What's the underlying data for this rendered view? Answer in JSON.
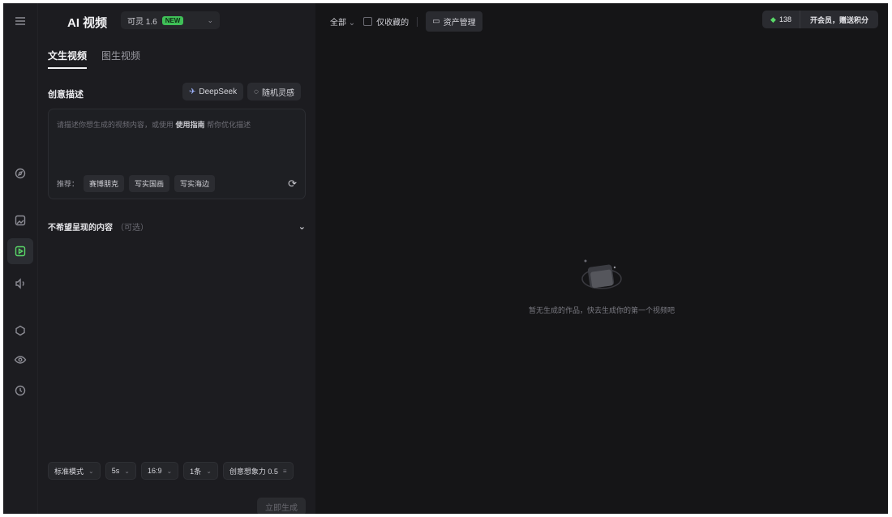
{
  "app": {
    "title": "AI 视频"
  },
  "model": {
    "name": "可灵 1.6",
    "badge": "NEW"
  },
  "tabs": [
    {
      "label": "文生视频"
    },
    {
      "label": "图生视频"
    }
  ],
  "prompt": {
    "section_label": "创意描述",
    "deepseek_label": "DeepSeek",
    "inspire_label": "随机灵感",
    "placeholder_before": "请描述你想生成的视频内容，或使用",
    "placeholder_link": "使用指南",
    "placeholder_after": "帮你优化描述",
    "try_label": "推荐：",
    "suggestions": [
      "赛博朋克",
      "写实国画",
      "写实海边"
    ]
  },
  "negative": {
    "label": "不希望呈现的内容",
    "hint": "（可选）"
  },
  "settings": {
    "mode": "标准模式",
    "duration": "5s",
    "ratio": "16:9",
    "count": "1条",
    "creativity": "创意想象力 0.5"
  },
  "generate_label": "立即生成",
  "topbar": {
    "filter_label": "全部",
    "checkbox_label": "仅收藏的",
    "assets_label": "资产管理"
  },
  "credits": {
    "amount": "138",
    "vip_label": "开会员，赠送积分"
  },
  "empty": {
    "text": "暂无生成的作品，快去生成你的第一个视频吧"
  },
  "colors": {
    "accent": "#59d868",
    "bg": "#161618",
    "panel": "#1c1c20"
  }
}
